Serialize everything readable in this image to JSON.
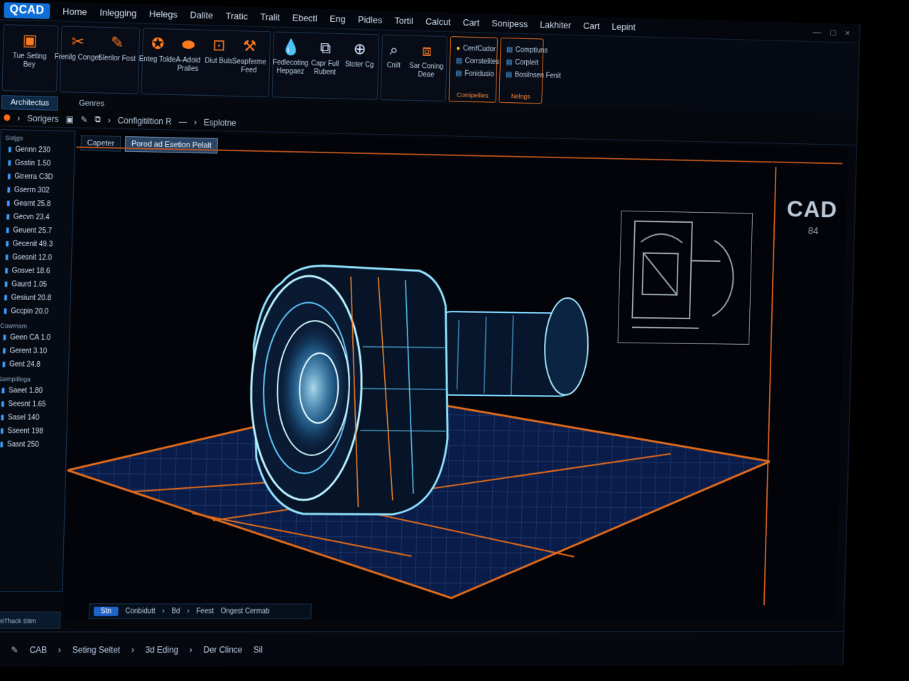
{
  "app": {
    "logo": "QCAD",
    "window_controls": [
      "—",
      "□",
      "×"
    ]
  },
  "menu": [
    "Home",
    "Inlegging",
    "Helegs",
    "Dalite",
    "Tratic",
    "Tralit",
    "Ebectl",
    "Eng",
    "Pidles",
    "Tortil",
    "Calcut",
    "Cart",
    "Sonipess",
    "Lakhiter",
    "Cart",
    "Lepint"
  ],
  "ribbon": {
    "group1": {
      "label": "Tue Seting Bey",
      "icon": "folder-icon"
    },
    "group2": [
      {
        "label": "Frenilg Conget",
        "icon": "tools-icon"
      },
      {
        "label": "Slerilor Fost",
        "icon": "pencil-icon"
      }
    ],
    "group3": [
      {
        "label": "Enteg Tolde",
        "icon": "lightbulb-icon"
      },
      {
        "label": "A-Adoid Pralies",
        "icon": "eraser-icon"
      },
      {
        "label": "Diut Buls",
        "icon": "box-icon"
      },
      {
        "label": "Seapferme Feed",
        "icon": "wrench-icon"
      }
    ],
    "group4": [
      {
        "label": "Fedlecoting Hepgaez",
        "icon": "drop-icon"
      },
      {
        "label": "Capr Full Rubent",
        "icon": "frame-icon"
      },
      {
        "label": "Stoter Cg",
        "icon": "globe-icon"
      }
    ],
    "group5": [
      {
        "label": "Cnilt",
        "icon": "search-icon"
      },
      {
        "label": "Sar Coning Deae",
        "icon": "layers-icon"
      }
    ],
    "group6": {
      "rows": [
        "CenfCudor",
        "Corrstelites",
        "Fonidusio"
      ],
      "caption": "Comipeilies"
    },
    "group7": {
      "rows": [
        "Comptiuns",
        "Corpleit",
        "Bosilnsen Fenit"
      ],
      "caption": "Nelngs"
    }
  },
  "tabs": [
    {
      "label": "Architectus"
    },
    {
      "label": "Genres"
    }
  ],
  "pathbar": {
    "items": [
      "Sorigers",
      "Configitiltion R",
      "Esplotne"
    ]
  },
  "leftpanel": {
    "sections": [
      {
        "title": "Sotjgs",
        "items": [
          "Gennn 230",
          "Gsstin 1.50",
          "Gtrerra C3D",
          "Gserrn 302",
          "Geamt 25.8",
          "Gecvn 23.4",
          "Geuent 25.7",
          "Gecenit 49.3",
          "Gsesnit 12.0",
          "Gosvet 18.6",
          "Gaurd 1.05",
          "Gesiunt 20.8",
          "Gccpin 20.0"
        ]
      },
      {
        "title": "Cowrnsm",
        "items": [
          "Geen CA 1.0",
          "Gerent 3.10",
          "Gent 24.8"
        ]
      },
      {
        "title": "Sempitlega",
        "items": [
          "Saeet 1.80",
          "Seesnt 1.65",
          "Sasel 140",
          "Sseent 198",
          "Sasnt 250"
        ]
      }
    ],
    "footer": "FimiThack Sttm"
  },
  "viewport": {
    "tabs": [
      "Capeter",
      "Porod ad Esetion Pelalt"
    ],
    "watermark": "CAD",
    "watermark_sub": "84"
  },
  "command_bar": {
    "pill": "Stn",
    "items": [
      "Conbidutt",
      "Bd",
      "Feest",
      "Ongest Cermab"
    ]
  },
  "statusbar": {
    "items": [
      "CAB",
      "Seting Seltet",
      "3d Eding",
      "Der Clince",
      "Sil"
    ]
  }
}
